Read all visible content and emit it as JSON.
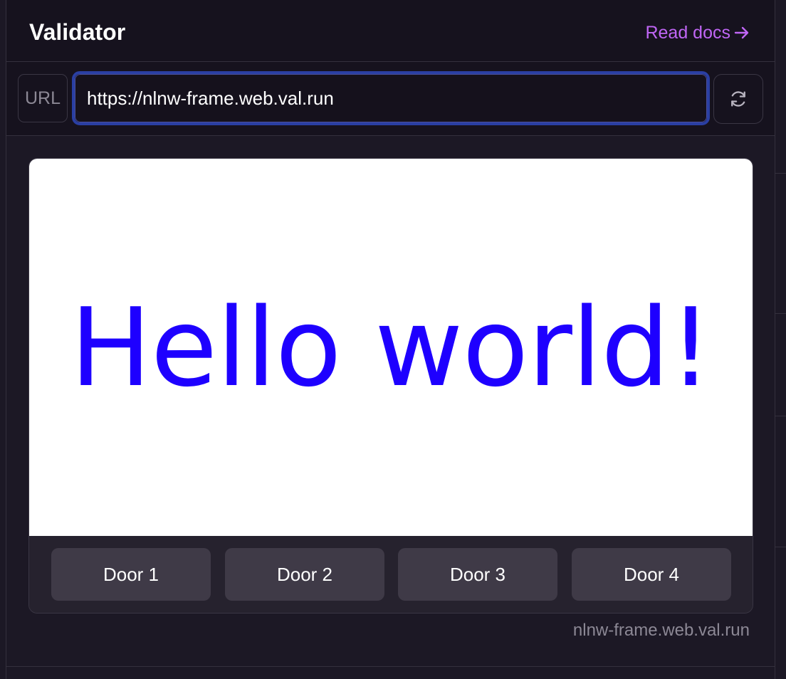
{
  "header": {
    "title": "Validator",
    "docs_link": "Read docs"
  },
  "url_bar": {
    "label": "URL",
    "value": "https://nlnw-frame.web.val.run"
  },
  "frame": {
    "image_text": "Hello world!",
    "image_text_color": "#1e00ff",
    "buttons": [
      "Door 1",
      "Door 2",
      "Door 3",
      "Door 4"
    ],
    "host": "nlnw-frame.web.val.run"
  },
  "colors": {
    "accent": "#c066f5",
    "background": "#1c1825",
    "focus_ring": "#2a3fa3"
  },
  "icons": {
    "docs_arrow": "arrow-right-icon",
    "refresh": "refresh-icon"
  }
}
